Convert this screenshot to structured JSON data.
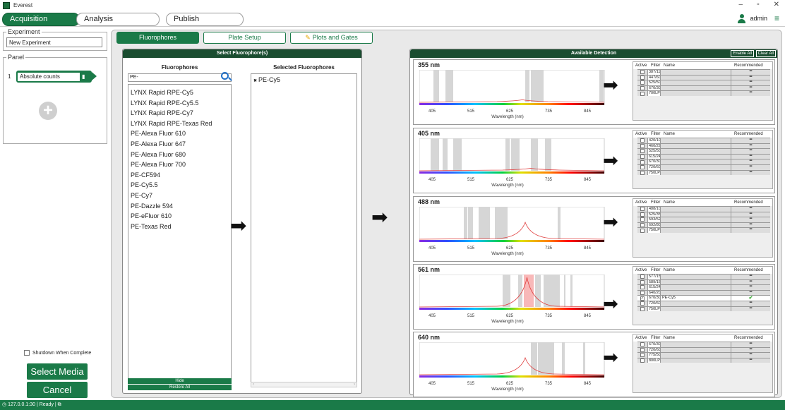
{
  "window": {
    "title": "Everest"
  },
  "top_tabs": [
    "Acquisition",
    "Analysis",
    "Publish"
  ],
  "user": {
    "name": "admin"
  },
  "experiment": {
    "legend": "Experiment",
    "value": "New Experiment"
  },
  "panel": {
    "legend": "Panel",
    "index": "1",
    "name": "Absolute counts"
  },
  "shutdown_label": "Shutdown When Complete",
  "select_media_label": "Select Media",
  "cancel_label": "Cancel",
  "sub_tabs": [
    "Fluorophores",
    "Plate Setup",
    "Plots and Gates"
  ],
  "select_panel": {
    "title": "Select Fluorophore(s)",
    "fluor_header": "Fluorophores",
    "selected_header": "Selected Fluorophores",
    "search_value": "PE-",
    "fluorophores": [
      "LYNX Rapid RPE-Cy5",
      "LYNX Rapid RPE-Cy5.5",
      "LYNX Rapid RPE-Cy7",
      "LYNX Rapid RPE-Texas Red",
      "PE-Alexa Fluor 610",
      "PE-Alexa Fluor 647",
      "PE-Alexa Fluor 680",
      "PE-Alexa Fluor 700",
      "PE-CF594",
      "PE-Cy5.5",
      "PE-Cy7",
      "PE-Dazzle 594",
      "PE-eFluor 610",
      "PE-Texas Red"
    ],
    "selected": [
      "PE-Cy5"
    ],
    "hide_label": "Hide",
    "restore_label": "Restore All"
  },
  "detection": {
    "title": "Available Detection",
    "enable_all": "Enable All",
    "clear_all": "Clear All",
    "axis_ticks": [
      "405",
      "515",
      "625",
      "735",
      "845"
    ],
    "axis_label": "Wavelength (nm)",
    "col_active": "Active",
    "col_filter": "Filter",
    "col_name": "Name",
    "col_recommended": "Recommended",
    "lasers": [
      {
        "name": "355 nm",
        "filters": [
          "387/11",
          "447/60",
          "525/50",
          "670/30",
          "700LP"
        ]
      },
      {
        "name": "405 nm",
        "filters": [
          "420/10",
          "460/22",
          "525/50",
          "615/24",
          "670/30",
          "720/60",
          "750LP"
        ]
      },
      {
        "name": "488 nm",
        "filters": [
          "488/10",
          "525/35",
          "593/52",
          "692/80",
          "750LP"
        ]
      },
      {
        "name": "561 nm",
        "filters": [
          "577/15",
          "589/15",
          "615/24",
          "640/20",
          "670/30",
          "720/60",
          "750LP"
        ],
        "checked_filter": "670/30",
        "checked_name": "PE-Cy5"
      },
      {
        "name": "640 nm",
        "filters": [
          "670/30",
          "720/60",
          "775/50",
          "800LP"
        ]
      }
    ]
  },
  "status": {
    "address": "127.0.0.1:30",
    "state": "Ready"
  }
}
